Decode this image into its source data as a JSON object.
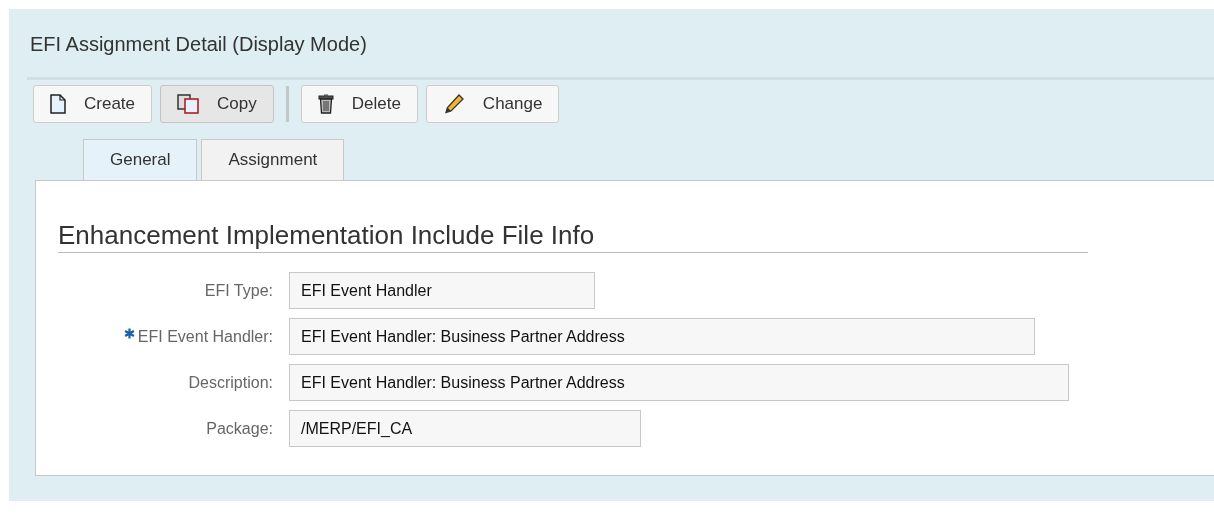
{
  "window": {
    "title": "EFI Assignment Detail (Display Mode)"
  },
  "toolbar": [
    {
      "kind": "button",
      "label": "Create",
      "pressed": false
    },
    {
      "kind": "button",
      "label": "Copy",
      "pressed": true
    },
    {
      "kind": "separator"
    },
    {
      "kind": "button",
      "label": "Delete",
      "pressed": false
    },
    {
      "kind": "button",
      "label": "Change",
      "pressed": false
    }
  ],
  "tabs": [
    {
      "label": "General",
      "selected": true
    },
    {
      "label": "Assignment",
      "selected": false
    }
  ],
  "section": {
    "title": "Enhancement Implementation Include File Info",
    "fields": [
      {
        "label": "EFI Type:",
        "value": "EFI Event Handler",
        "required": false
      },
      {
        "label": "EFI Event Handler:",
        "value": "EFI Event Handler: Business Partner Address",
        "required": true
      },
      {
        "label": "Description:",
        "value": "EFI Event Handler: Business Partner Address",
        "required": false
      },
      {
        "label": "Package:",
        "value": "/MERP/EFI_CA",
        "required": false
      }
    ]
  }
}
